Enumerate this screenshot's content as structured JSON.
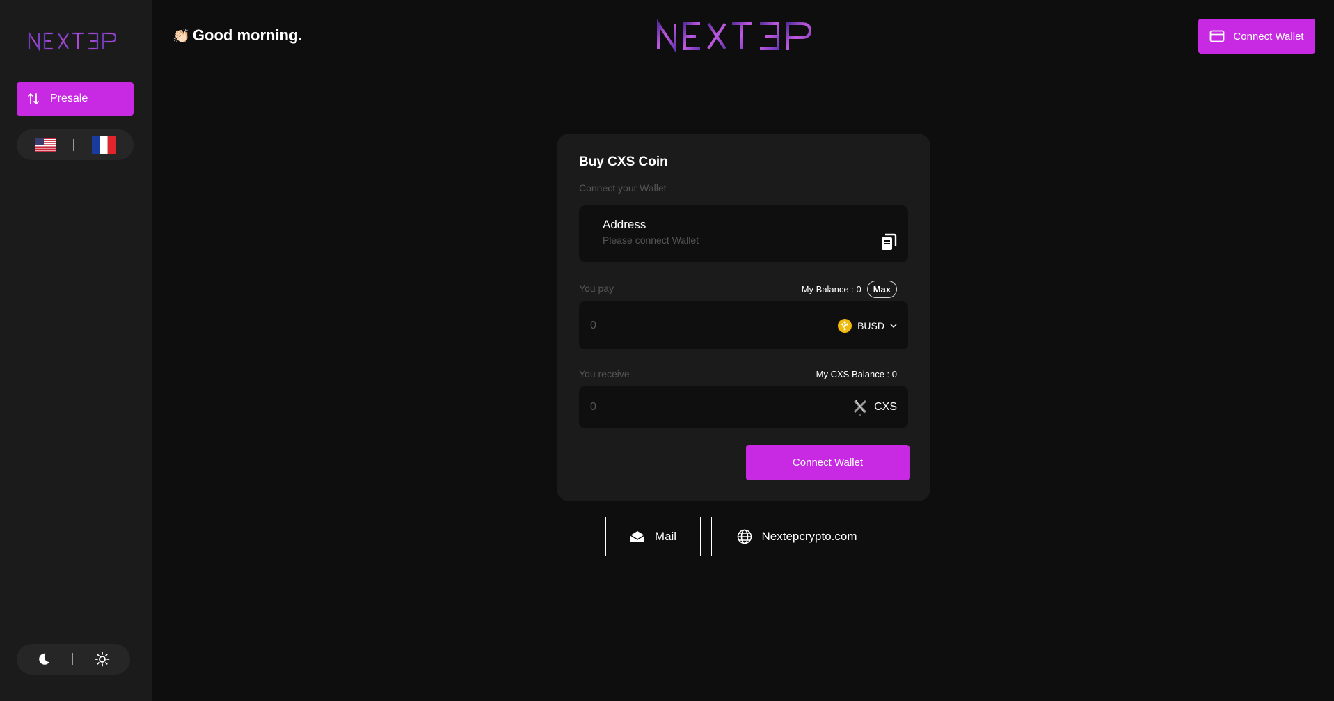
{
  "brand": {
    "name": "NEXTEP",
    "accent": "#c82ae3"
  },
  "sidebar": {
    "presale_label": "Presale",
    "languages": [
      "en-flag-icon",
      "fr-flag-icon"
    ],
    "theme_modes": [
      "moon-icon",
      "sun-icon"
    ]
  },
  "header": {
    "greeting_emoji": "👏🏻",
    "greeting": "Good morning.",
    "connect_label": "Connect Wallet"
  },
  "card": {
    "title": "Buy CXS Coin",
    "subtitle": "Connect your Wallet",
    "address_label": "Address",
    "address_value": "Please connect Wallet",
    "pay_label": "You pay",
    "my_balance": "My Balance : 0",
    "max_label": "Max",
    "pay_placeholder": "0",
    "pay_token": "BUSD",
    "receive_label": "You receive",
    "my_cxs_balance": "My CXS Balance : 0",
    "receive_placeholder": "0",
    "receive_token": "CXS",
    "connect_label": "Connect Wallet"
  },
  "links": {
    "mail_label": "Mail",
    "site_label": "Nextepcrypto.com"
  }
}
